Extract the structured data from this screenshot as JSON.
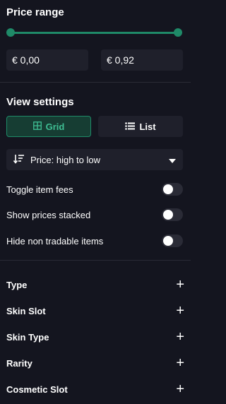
{
  "price_range": {
    "title": "Price range",
    "min_value": "€ 0,00",
    "max_value": "€ 0,92",
    "slider_min_fraction": 0,
    "slider_max_fraction": 1
  },
  "view_settings": {
    "title": "View settings",
    "grid_label": "Grid",
    "list_label": "List",
    "active_view": "grid",
    "sort_label": "Price: high to low"
  },
  "toggles": [
    {
      "label": "Toggle item fees",
      "on": false
    },
    {
      "label": "Show prices stacked",
      "on": false
    },
    {
      "label": "Hide non tradable items",
      "on": false
    }
  ],
  "filters": [
    {
      "label": "Type"
    },
    {
      "label": "Skin Slot"
    },
    {
      "label": "Skin Type"
    },
    {
      "label": "Rarity"
    },
    {
      "label": "Cosmetic Slot"
    }
  ],
  "colors": {
    "background": "#14151f",
    "accent": "#1f8a68",
    "accent_text": "#3fbf94",
    "panel": "#1f202b"
  },
  "icons": {
    "grid": "grid-icon",
    "list": "list-icon",
    "sort": "sort-descending-icon",
    "dropdown": "chevron-down-icon",
    "expand": "plus-icon"
  }
}
